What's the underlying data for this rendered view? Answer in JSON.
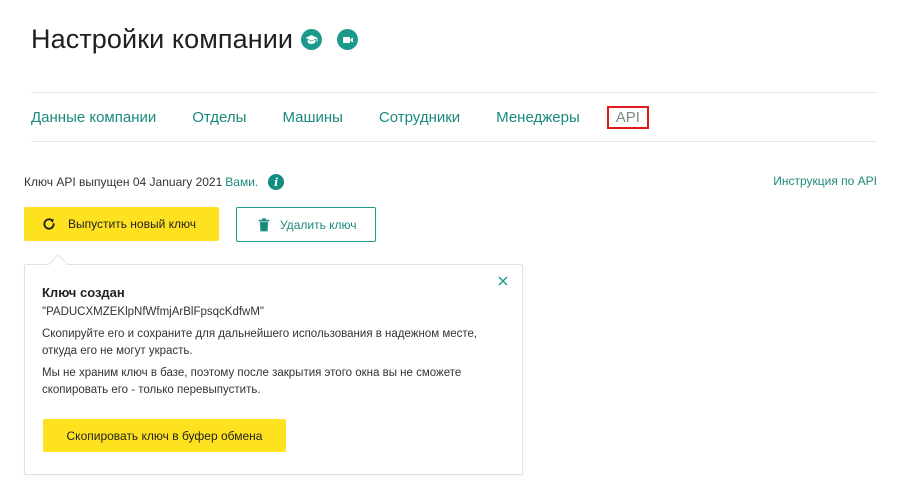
{
  "header": {
    "title": "Настройки компании",
    "icons": [
      "graduation-cap-icon",
      "video-camera-icon"
    ],
    "accent_color": "#1b9a8c"
  },
  "tabs": [
    {
      "label": "Данные компании",
      "active": false
    },
    {
      "label": "Отделы",
      "active": false
    },
    {
      "label": "Машины",
      "active": false
    },
    {
      "label": "Сотрудники",
      "active": false
    },
    {
      "label": "Менеджеры",
      "active": false
    },
    {
      "label": "API",
      "active": true
    }
  ],
  "key_info": {
    "text": "Ключ API выпущен 04 January 2021",
    "by_link": "Вами.",
    "info_icon": "i"
  },
  "api_docs_link": "Инструкция по API",
  "buttons": {
    "new_key": "Выпустить новый ключ",
    "delete_key": "Удалить ключ"
  },
  "popover": {
    "title": "Ключ создан",
    "key": "\"PADUCXMZEKlpNfWfmjArBlFpsqcKdfwM\"",
    "paragraph1": "Скопируйте его и сохраните для дальнейшего использования в надежном месте, откуда его не могут украсть.",
    "paragraph2": "Мы не храним ключ в базе, поэтому после закрытия этого окна вы не сможете скопировать его - только перевыпустить.",
    "copy_button": "Скопировать ключ в буфер обмена"
  },
  "colors": {
    "primary_yellow": "#ffe21f",
    "link_teal": "#1b8a7d",
    "highlight_red": "#e01a1a"
  }
}
